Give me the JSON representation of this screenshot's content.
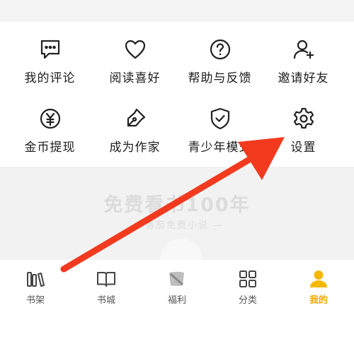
{
  "menu": {
    "items": [
      {
        "label": "我的评论",
        "icon": "comment-icon"
      },
      {
        "label": "阅读喜好",
        "icon": "heart-icon"
      },
      {
        "label": "帮助与反馈",
        "icon": "help-icon"
      },
      {
        "label": "邀请好友",
        "icon": "add-user-icon"
      },
      {
        "label": "金币提现",
        "icon": "coin-icon"
      },
      {
        "label": "成为作家",
        "icon": "pen-icon"
      },
      {
        "label": "青少年模式",
        "icon": "shield-icon"
      },
      {
        "label": "设置",
        "icon": "gear-icon"
      }
    ]
  },
  "promo": {
    "headline": "免费看书100年",
    "subtitle": "— 番茄免费小说 —"
  },
  "tabbar": {
    "tabs": [
      {
        "label": "书架",
        "icon": "bookshelf-icon"
      },
      {
        "label": "书城",
        "icon": "book-icon"
      },
      {
        "label": "福利",
        "icon": "gift-icon"
      },
      {
        "label": "分类",
        "icon": "category-icon"
      },
      {
        "label": "我的",
        "icon": "profile-icon",
        "active": true
      }
    ]
  },
  "annotation": {
    "color": "#f23a1f"
  },
  "colors": {
    "active_tab": "#f0a800",
    "text": "#1d1d1d"
  }
}
